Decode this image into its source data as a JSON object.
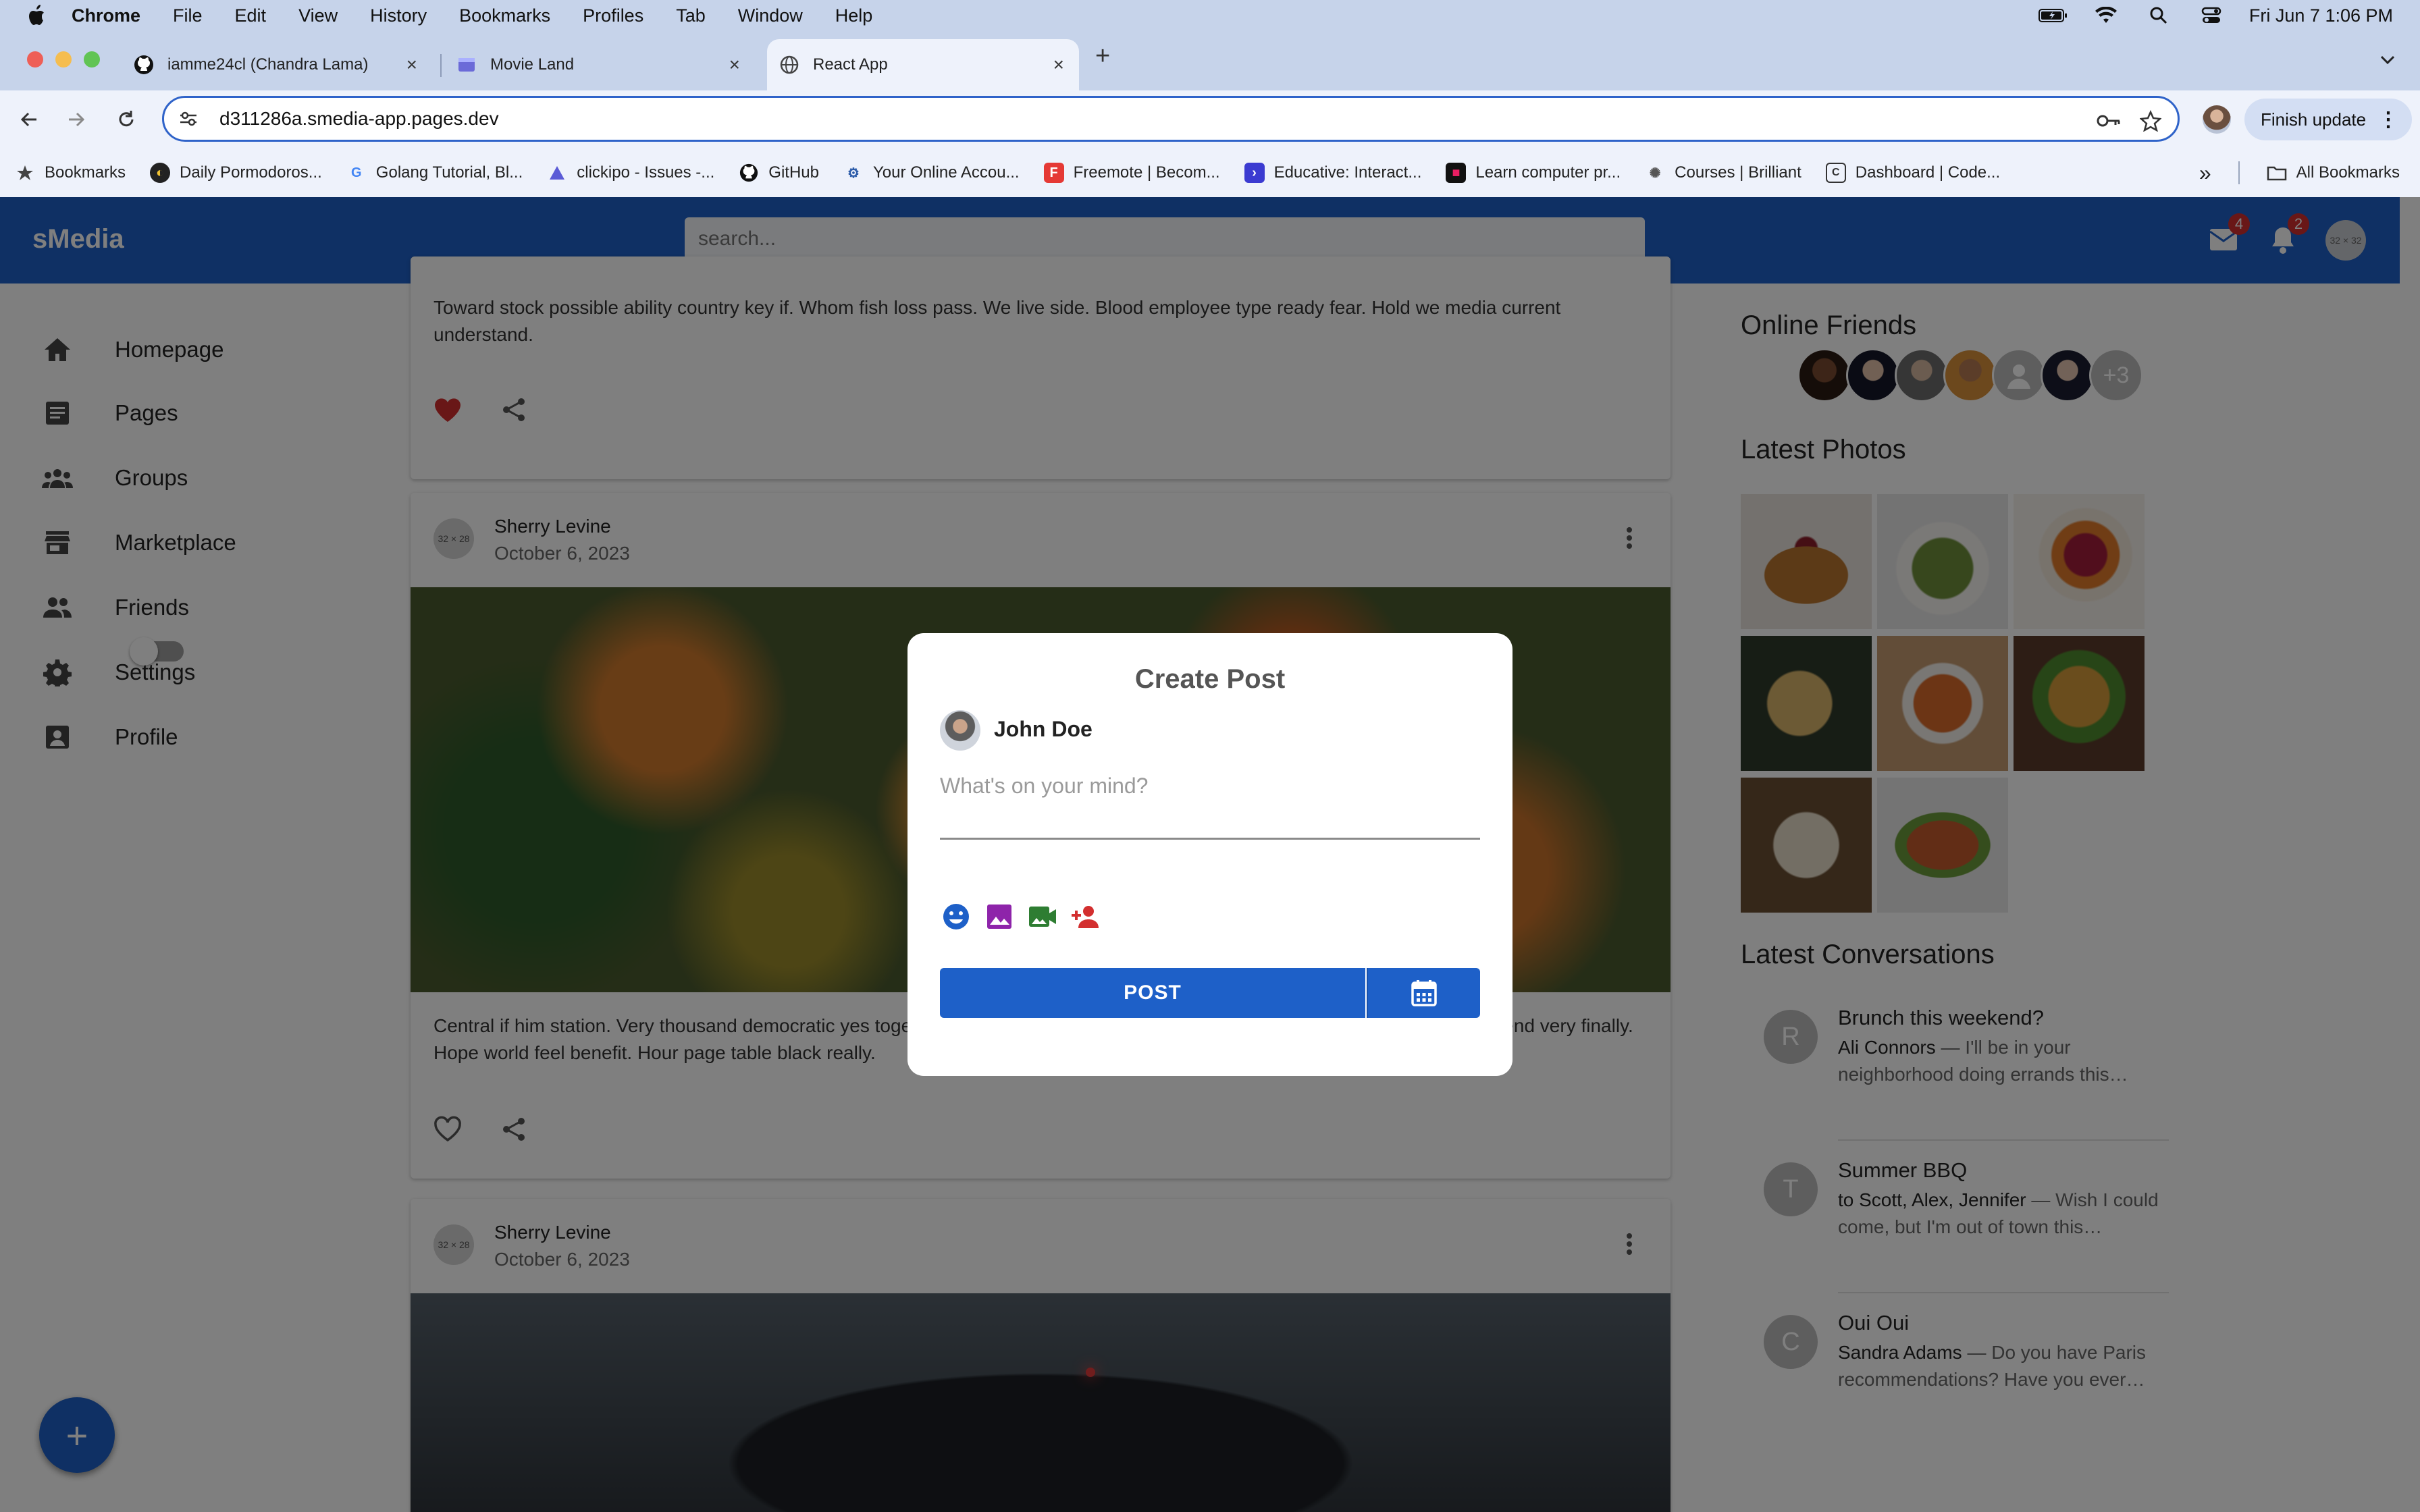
{
  "menubar": {
    "app": "Chrome",
    "items": [
      "File",
      "Edit",
      "View",
      "History",
      "Bookmarks",
      "Profiles",
      "Tab",
      "Window",
      "Help"
    ],
    "datetime": "Fri Jun 7  1:06 PM",
    "icons": [
      "battery-icon",
      "wifi-icon",
      "spotlight-icon",
      "control-center-icon"
    ]
  },
  "tabs": [
    {
      "title": "iamme24cl (Chandra Lama)",
      "icon": "github-icon",
      "active": false
    },
    {
      "title": "Movie Land",
      "icon": "movie-icon",
      "active": false
    },
    {
      "title": "React App",
      "icon": "globe-icon",
      "active": true
    }
  ],
  "toolbar": {
    "url": "d311286a.smedia-app.pages.dev",
    "finish_update": "Finish update"
  },
  "bookmarks": {
    "items": [
      {
        "label": "Bookmarks",
        "icon": "star-icon"
      },
      {
        "label": "Daily Pormodoros...",
        "icon": "pomodoro-icon"
      },
      {
        "label": "Golang Tutorial, Bl...",
        "icon": "google-icon"
      },
      {
        "label": "clickipo - Issues -...",
        "icon": "clickup-icon"
      },
      {
        "label": "GitHub",
        "icon": "github-icon"
      },
      {
        "label": "Your Online Accou...",
        "icon": "account-icon"
      },
      {
        "label": "Freemote | Becom...",
        "icon": "freemote-icon"
      },
      {
        "label": "Educative: Interact...",
        "icon": "educative-icon"
      },
      {
        "label": "Learn computer pr...",
        "icon": "learn-icon"
      },
      {
        "label": "Courses | Brilliant",
        "icon": "brilliant-icon"
      },
      {
        "label": "Dashboard | Code...",
        "icon": "code-icon"
      }
    ],
    "all_bookmarks": "All Bookmarks"
  },
  "app": {
    "brand": "sMedia",
    "search_placeholder": "search...",
    "mail_count": "4",
    "notification_count": "2",
    "avatar_text": "32 × 32"
  },
  "sidebar": {
    "items": [
      {
        "label": "Homepage",
        "icon": "home-icon"
      },
      {
        "label": "Pages",
        "icon": "article-icon"
      },
      {
        "label": "Groups",
        "icon": "groups-icon"
      },
      {
        "label": "Marketplace",
        "icon": "store-icon"
      },
      {
        "label": "Friends",
        "icon": "people-icon"
      },
      {
        "label": "Settings",
        "icon": "gear-icon"
      },
      {
        "label": "Profile",
        "icon": "account-box-icon"
      }
    ]
  },
  "posts": [
    {
      "text": "Toward stock possible ability country key if. Whom fish loss pass. We live side. Blood employee type ready fear. Hold we media current understand.",
      "liked": true
    },
    {
      "author": "Sherry Levine",
      "date": "October 6, 2023",
      "avatar_text": "32 × 28",
      "text": "Central if him station. Very thousand democratic yes together cultural answer reflect. Seven something. Stock tree picture ball friend very finally. Hope world feel benefit. Hour page table black really.",
      "liked": false
    },
    {
      "author": "Sherry Levine",
      "date": "October 6, 2023",
      "avatar_text": "32 × 28"
    }
  ],
  "right": {
    "online_friends_title": "Online Friends",
    "more_friends": "+3",
    "latest_photos_title": "Latest Photos",
    "latest_conversations_title": "Latest Conversations",
    "conversations": [
      {
        "initial": "R",
        "title": "Brunch this weekend?",
        "from": "Ali Connors",
        "snippet": " — I'll be in your neighborhood doing errands this…"
      },
      {
        "initial": "T",
        "title": "Summer BBQ",
        "from": "to Scott, Alex, Jennifer",
        "snippet": " — Wish I could come, but I'm out of town this…"
      },
      {
        "initial": "C",
        "title": "Oui Oui",
        "from": "Sandra Adams",
        "snippet": " — Do you have Paris recommendations? Have you ever…"
      }
    ]
  },
  "modal": {
    "title": "Create Post",
    "user": "John Doe",
    "placeholder": "What's on your mind?",
    "post_label": "POST",
    "accent": "#1e60c8"
  },
  "fab_label": "+"
}
